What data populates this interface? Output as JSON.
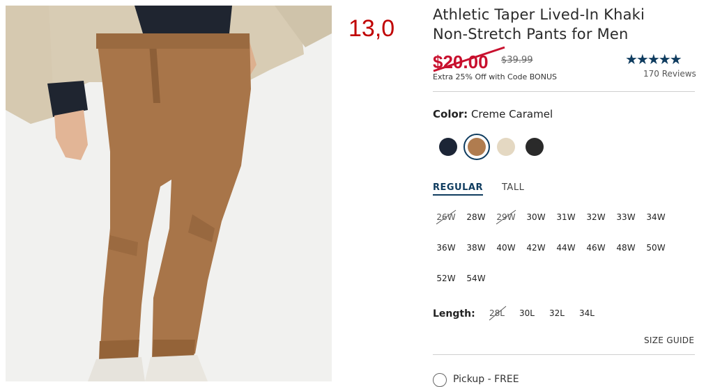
{
  "annotation": "13,0",
  "product": {
    "title_line1": "Athletic Taper Lived-In Khaki",
    "title_line2": "Non-Stretch Pants for Men",
    "sale_price": "$20.00",
    "original_price": "$39.99",
    "promo": "Extra 25% Off with Code BONUS",
    "stars": "★★★★★",
    "rating": 5,
    "reviews": "170 Reviews"
  },
  "color": {
    "label": "Color:",
    "selected": "Creme Caramel",
    "swatches": [
      {
        "name": "navy",
        "hex": "#1c2536"
      },
      {
        "name": "creme-caramel",
        "hex": "#b07c4f",
        "selected": true
      },
      {
        "name": "khaki-light",
        "hex": "#e4d8c2"
      },
      {
        "name": "black",
        "hex": "#2a2a2a"
      }
    ]
  },
  "fit_tabs": {
    "regular": "REGULAR",
    "tall": "TALL"
  },
  "waist_sizes": [
    "26W",
    "28W",
    "29W",
    "30W",
    "31W",
    "32W",
    "33W",
    "34W",
    "36W",
    "38W",
    "40W",
    "42W",
    "44W",
    "46W",
    "48W",
    "50W",
    "52W",
    "54W"
  ],
  "length": {
    "label": "Length:",
    "sizes": [
      "28L",
      "30L",
      "32L",
      "34L"
    ]
  },
  "size_guide": "SIZE GUIDE",
  "pickup": "Pickup - FREE",
  "colors": {
    "accent": "#0f3c5f",
    "sale_red": "#c8102e",
    "annotation_red": "#c00000"
  }
}
